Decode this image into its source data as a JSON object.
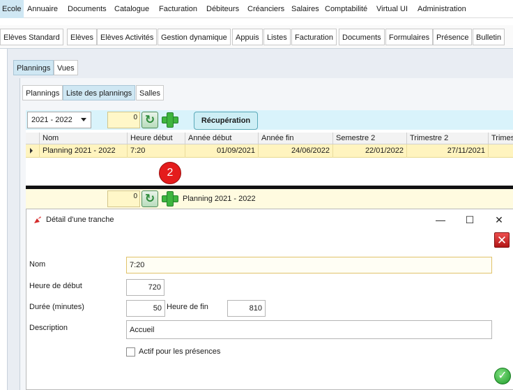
{
  "menu": {
    "items": [
      "Ecole",
      "Annuaire",
      "Documents",
      "Catalogue",
      "Facturation",
      "Débiteurs",
      "Créanciers",
      "Salaires",
      "Comptabilité",
      "Virtual UI",
      "Administration"
    ],
    "active": "Ecole"
  },
  "module_tabs": [
    "Elèves Standard",
    "Elèves",
    "Elèves Activités",
    "Gestion dynamique",
    "Appuis",
    "Listes",
    "Facturation",
    "Documents",
    "Formulaires",
    "Présence",
    "Bulletin"
  ],
  "outer_tabs": {
    "plannings": "Plannings",
    "vues": "Vues"
  },
  "inner_tabs": {
    "plannings": "Plannings",
    "liste": "Liste des plannings",
    "salles": "Salles"
  },
  "toolbar": {
    "year_select": "2021 - 2022",
    "count": "0",
    "refresh_icon": "refresh-icon",
    "add_icon": "plus-icon",
    "recuperation_label": "Récupération"
  },
  "grid": {
    "columns": [
      "Nom",
      "Heure début",
      "Année début",
      "Année fin",
      "Semestre 2",
      "Trimestre 2",
      "Trimes"
    ],
    "rows": [
      {
        "nom": "Planning 2021 - 2022",
        "heure_debut": "7:20",
        "annee_debut": "01/09/2021",
        "annee_fin": "24/06/2022",
        "semestre2": "22/01/2022",
        "trimestre2": "27/11/2021",
        "trimestre3": ""
      }
    ]
  },
  "badge": "2",
  "toolbar2": {
    "count": "0",
    "planning_label": "Planning 2021 - 2022"
  },
  "dialog": {
    "title": "Détail d'une tranche",
    "minimize": "—",
    "maximize": "☐",
    "close": "✕",
    "fields": {
      "nom_label": "Nom",
      "nom_value": "7:20",
      "heure_label": "Heure de début",
      "heure_value": "720",
      "duree_label": "Durée (minutes)",
      "duree_value": "50",
      "fin_label": "Heure de fin",
      "fin_value": "810",
      "desc_label": "Description",
      "desc_value": "Accueil",
      "actif_label": "Actif pour les présences"
    },
    "colors": {
      "accent_cyan": "#d9f3fb",
      "row_yellow": "#fff4bf",
      "badge_red": "#e41c1c",
      "ok_green": "#1f9a2a"
    }
  }
}
